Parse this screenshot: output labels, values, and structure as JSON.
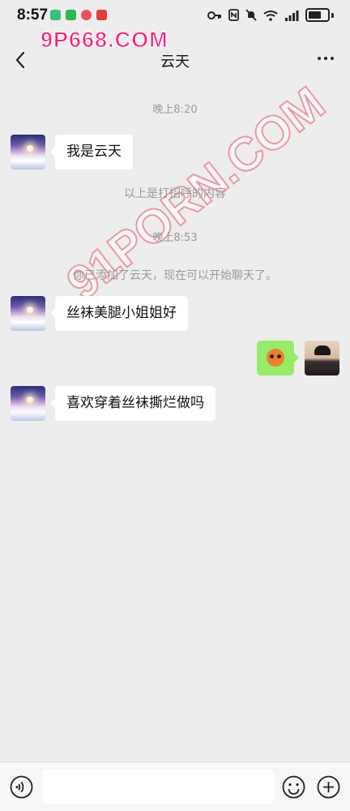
{
  "status_bar": {
    "time": "8:57"
  },
  "watermark": {
    "top_text": "9P668.COM",
    "diag_text": "91PORN.COM"
  },
  "nav": {
    "title": "云天"
  },
  "messages": {
    "time1": "晚上8:20",
    "msg1": "我是云天",
    "greeting_note": "以上是打招呼的内容",
    "time2": "晚上8:53",
    "added_note": "你已添加了云天，现在可以开始聊天了。",
    "msg2": "丝袜美腿小姐姐好",
    "msg3": "喜欢穿着丝袜撕烂做吗"
  },
  "colors": {
    "background": "#ededed",
    "self_bubble": "#95ec69",
    "other_bubble": "#ffffff",
    "hint_text": "#9a9a9a",
    "watermark": "#ff1f7a"
  },
  "icons": {
    "back": "chevron-left-icon",
    "more": "more-dots-icon",
    "voice": "voice-icon",
    "emoji": "emoji-icon",
    "plus": "plus-icon"
  }
}
